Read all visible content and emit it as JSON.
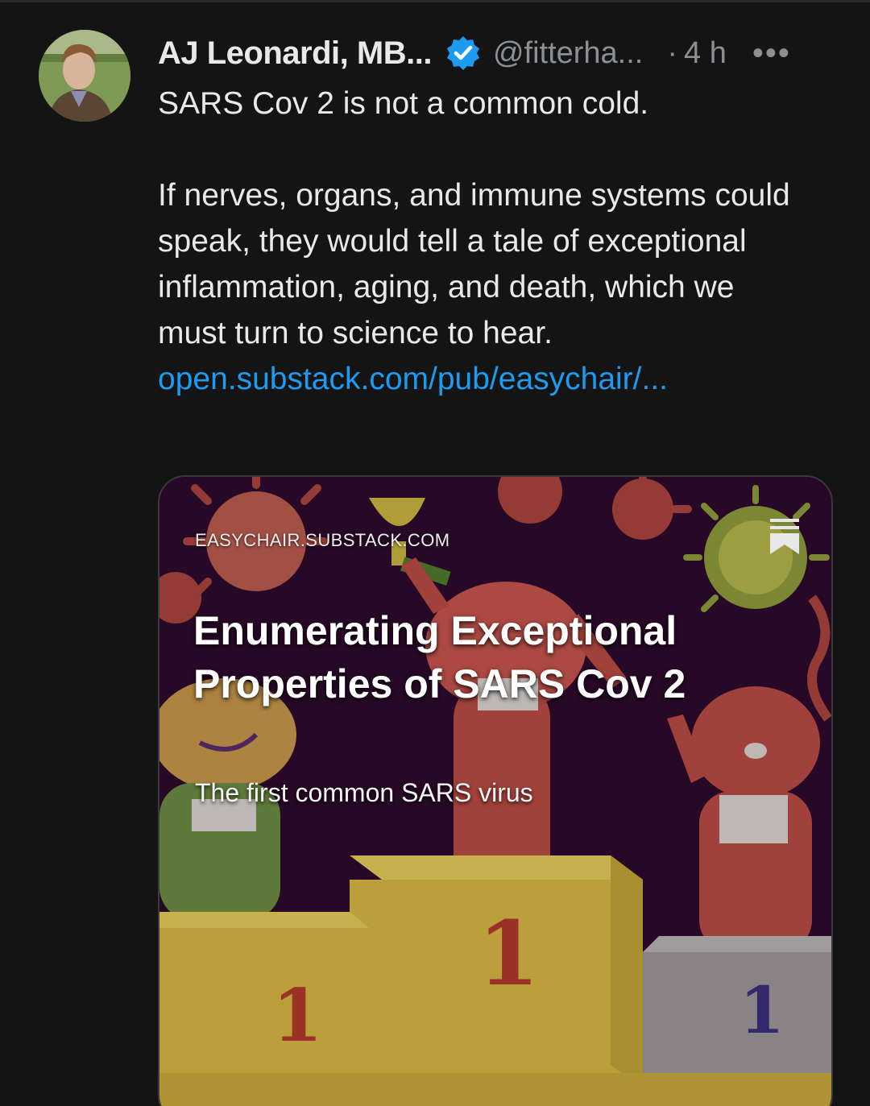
{
  "tweet": {
    "author_name": "AJ Leonardi, MB...",
    "handle": "@fitterha...",
    "separator": "·",
    "time": "4 h",
    "more_label": "•••",
    "text_line_1": "SARS Cov 2 is not a common cold.",
    "text_paragraph_2": "If nerves, organs, and immune systems could speak, they would tell a tale of exceptional inflammation, aging, and death, which we must turn to science to hear.",
    "link_text": "open.substack.com/pub/easychair/..."
  },
  "link_card": {
    "domain": "EASYCHAIR.SUBSTACK.COM",
    "title": "Enumerating Exceptional Properties of SARS Cov 2",
    "subtitle": "The first common SARS virus",
    "podium_numbers": [
      "1",
      "1",
      "1"
    ]
  },
  "colors": {
    "background": "#141414",
    "text": "#e7e9ea",
    "muted": "#8b9096",
    "link": "#1d9bf0",
    "verified_badge": "#1d9bf0",
    "card_background": "#2b0a2a"
  },
  "icons": [
    "avatar-photo",
    "verified-badge-icon",
    "more-options-icon",
    "bookmark-icon"
  ]
}
